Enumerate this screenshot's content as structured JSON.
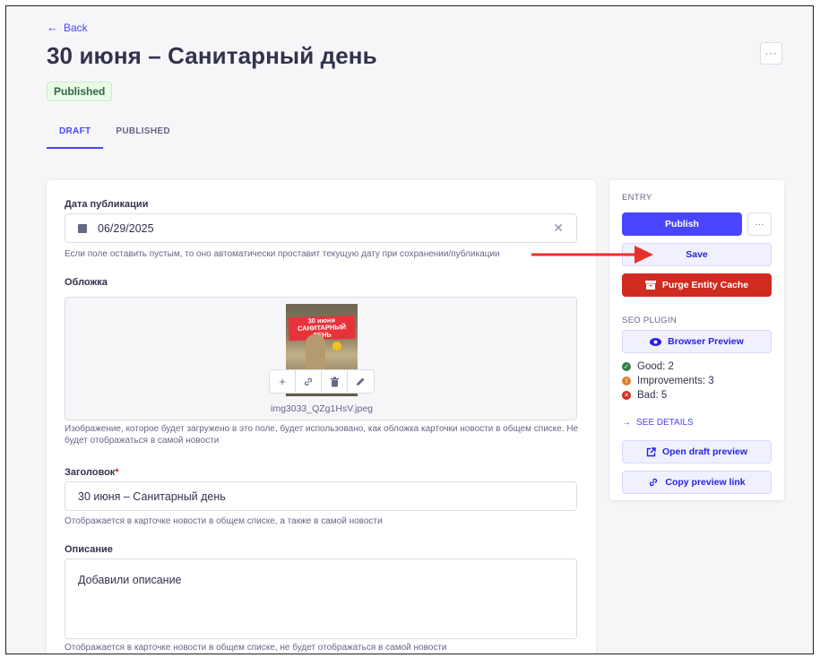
{
  "header": {
    "back_label": "Back",
    "title": "30 июня – Санитарный день",
    "status_badge": "Published",
    "more_label": "···"
  },
  "tabs": [
    {
      "label": "DRAFT",
      "active": true
    },
    {
      "label": "PUBLISHED",
      "active": false
    }
  ],
  "form": {
    "publish_date": {
      "label": "Дата публикации",
      "value": "06/29/2025",
      "hint": "Если поле оставить пустым, то оно автоматически проставит текущую дату при сохранении/публикации"
    },
    "cover": {
      "label": "Обложка",
      "filename": "img3033_QZg1HsV.jpeg",
      "image_text": "30 июня САНИТАРНЫЙ ДЕНЬ",
      "hint": "Изображение, которое будет загружено в это поле, будет использовано, как обложка карточки новости в общем списке. Не будет отображаться в самой новости"
    },
    "heading": {
      "label": "Заголовок",
      "required_mark": "*",
      "value": "30 июня – Санитарный день",
      "hint": "Отображается в карточке новости в общем списке, а также в самой новости"
    },
    "description": {
      "label": "Описание",
      "value": "Добавили описание",
      "hint": "Отображается в карточке новости в общем списке, не будет отображаться в самой новости"
    }
  },
  "sidebar": {
    "entry_title": "ENTRY",
    "publish_label": "Publish",
    "more_label": "···",
    "save_label": "Save",
    "purge_label": "Purge Entity Cache",
    "seo_title": "SEO PLUGIN",
    "browser_preview_label": "Browser Preview",
    "seo_good": "Good: 2",
    "seo_improvements": "Improvements: 3",
    "seo_bad": "Bad: 5",
    "see_details_label": "SEE DETAILS",
    "open_draft_preview_label": "Open draft preview",
    "copy_preview_link_label": "Copy preview link"
  },
  "colors": {
    "primary": "#4945ff",
    "danger": "#d02b20",
    "success": "#328048",
    "warning": "#d9822f",
    "annotation_arrow": "#e8302a"
  },
  "icons": {
    "back": "arrow-left-icon",
    "calendar": "calendar-icon",
    "clear": "close-icon",
    "add": "plus-icon",
    "link": "link-icon",
    "delete": "trash-icon",
    "edit": "pencil-icon",
    "purge": "archive-box-icon",
    "preview": "eye-icon",
    "external": "external-link-icon",
    "copy": "link-icon"
  }
}
